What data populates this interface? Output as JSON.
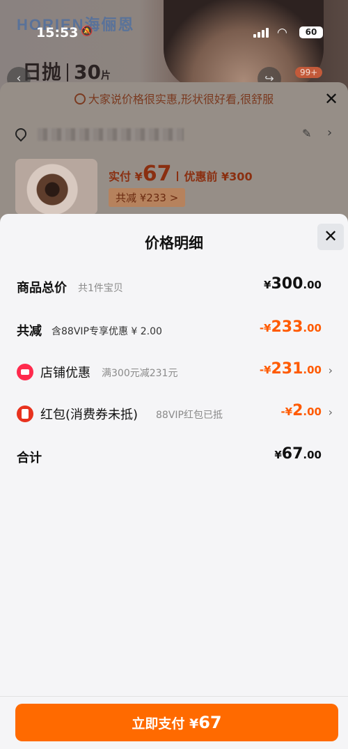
{
  "status_bar": {
    "time": "15:53",
    "battery": "60"
  },
  "background": {
    "brand": "HORIEN海俪恩",
    "daily_label": "日抛",
    "daily_count": "30",
    "daily_unit": "片",
    "cart_badge": "99+",
    "tip": "大家说价格很实惠,形状很好看,很舒服",
    "actual_pay_label": "实付 ¥",
    "actual_pay_value": "67",
    "before_discount": "优惠前 ¥300",
    "total_cut": "共减 ¥233 >"
  },
  "modal": {
    "title": "价格明细",
    "rows": [
      {
        "label": "商品总价",
        "sub": "共1件宝贝",
        "currency": "¥",
        "amount": "300",
        "cents": ".00"
      },
      {
        "label": "共减",
        "sub": "含88VIP专享优惠 ¥ 2.00",
        "currency": "-¥",
        "amount": "233",
        "cents": ".00"
      },
      {
        "label": "店铺优惠",
        "sub": "满300元减231元",
        "currency": "-¥",
        "amount": "231",
        "cents": ".00"
      },
      {
        "label": "红包(消费券未抵)",
        "sub": "88VIP红包已抵",
        "currency": "-¥",
        "amount": "2",
        "cents": ".00"
      },
      {
        "label": "合计",
        "sub": "",
        "currency": "¥",
        "amount": "67",
        "cents": ".00"
      }
    ]
  },
  "pay_button": {
    "label": "立即支付 ¥",
    "amount": "67"
  },
  "colors": {
    "accent": "#ff6a00",
    "discount": "#ff5a00",
    "store_icon": "#ff2a4d",
    "redpacket_icon": "#e8321e"
  }
}
